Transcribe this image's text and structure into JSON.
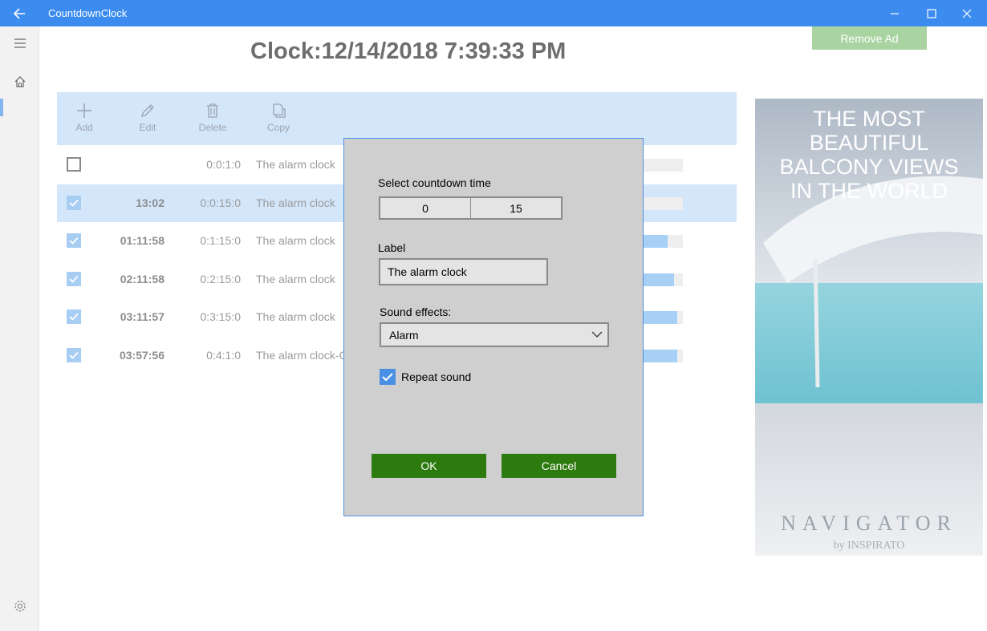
{
  "window": {
    "title": "CountdownClock"
  },
  "clock": {
    "text": "Clock:12/14/2018 7:39:33 PM"
  },
  "remove_ad": {
    "label": "Remove Ad"
  },
  "toolbar": {
    "add": "Add",
    "edit": "Edit",
    "delete": "Delete",
    "copy": "Copy"
  },
  "rows": [
    {
      "checked": false,
      "elapsed": "",
      "duration": "0:0:1:0",
      "label": "The alarm clock",
      "progress": 0.0
    },
    {
      "checked": true,
      "elapsed": "13:02",
      "duration": "0:0:15:0",
      "label": "The alarm clock",
      "progress": 0.0
    },
    {
      "checked": true,
      "elapsed": "01:11:58",
      "duration": "0:1:15:0",
      "label": "The alarm clock",
      "progress": 0.62
    },
    {
      "checked": true,
      "elapsed": "02:11:58",
      "duration": "0:2:15:0",
      "label": "The alarm clock",
      "progress": 0.78
    },
    {
      "checked": true,
      "elapsed": "03:11:57",
      "duration": "0:3:15:0",
      "label": "The alarm clock",
      "progress": 0.86
    },
    {
      "checked": true,
      "elapsed": "03:57:56",
      "duration": "0:4:1:0",
      "label": "The alarm clock-C",
      "progress": 0.86
    }
  ],
  "dialog": {
    "select_time_label": "Select countdown time",
    "hours": "0",
    "minutes": "15",
    "label_label": "Label",
    "label_value": "The alarm clock",
    "sound_label": "Sound effects:",
    "sound_value": "Alarm",
    "repeat_label": "Repeat sound",
    "repeat_checked": true,
    "ok": "OK",
    "cancel": "Cancel"
  },
  "ad": {
    "headline_1": "THE MOST BEAUTIFUL",
    "headline_2": "BALCONY VIEWS",
    "headline_3": "IN THE WORLD",
    "brand": "NAVIGATOR",
    "byline": "by INSPIRATO"
  },
  "colors": {
    "titlebar": "#3c8cf0",
    "button_green": "#2d7a0f",
    "selection": "#d4e6fa"
  }
}
